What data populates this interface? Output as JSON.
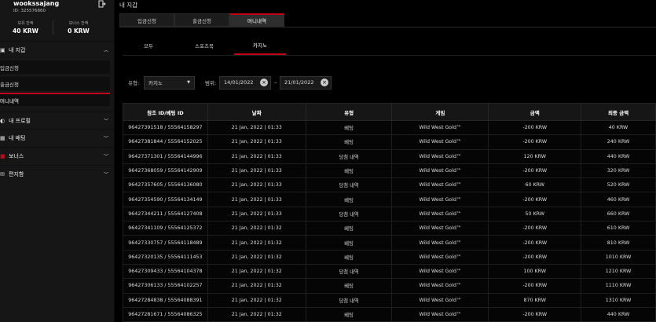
{
  "user": {
    "name": "wookssajang",
    "id": "ID: 325576860",
    "balance1_label": "보유 잔액",
    "balance1_value": "40 KRW",
    "balance2_label": "보너스 잔액",
    "balance2_value": "0 KRW"
  },
  "sidebar": {
    "wallet": "내 지갑",
    "wallet_items": [
      "입금신청",
      "출금신청",
      "머니내역"
    ],
    "profile": "내 프로필",
    "bets": "내 배팅",
    "bonus": "보너스",
    "messages": "편지함"
  },
  "page": {
    "title": "내 지갑"
  },
  "tabs": [
    "입금신청",
    "출금신청",
    "머니내역"
  ],
  "subtabs": [
    "모두",
    "스포츠북",
    "카지노"
  ],
  "filter": {
    "type_label": "유형:",
    "type_value": "카지노",
    "range_label": "범위:",
    "date_from": "14/01/2022",
    "date_to": "21/01/2022",
    "dash": "–"
  },
  "table": {
    "headers": [
      "참조 ID/베팅 ID",
      "날짜",
      "유형",
      "게임",
      "금액",
      "최종 금액"
    ],
    "rows": [
      [
        "96427391518 / 55564158297",
        "21 Jan, 2022 | 01:33",
        "베팅",
        "Wild West Gold™",
        "-200 KRW",
        "40 KRW"
      ],
      [
        "96427381844 / 55564152025",
        "21 Jan, 2022 | 01:33",
        "베팅",
        "Wild West Gold™",
        "-200 KRW",
        "240 KRW"
      ],
      [
        "96427371301 / 55564144996",
        "21 Jan, 2022 | 01:33",
        "당첨 내역",
        "Wild West Gold™",
        "120 KRW",
        "440 KRW"
      ],
      [
        "96427368059 / 55564142909",
        "21 Jan, 2022 | 01:33",
        "베팅",
        "Wild West Gold™",
        "-200 KRW",
        "320 KRW"
      ],
      [
        "96427357605 / 55564136080",
        "21 Jan, 2022 | 01:33",
        "당첨 내역",
        "Wild West Gold™",
        "60 KRW",
        "520 KRW"
      ],
      [
        "96427354590 / 55564134149",
        "21 Jan, 2022 | 01:33",
        "베팅",
        "Wild West Gold™",
        "-200 KRW",
        "460 KRW"
      ],
      [
        "96427344211 / 55564127408",
        "21 Jan, 2022 | 01:33",
        "당첨 내역",
        "Wild West Gold™",
        "50 KRW",
        "660 KRW"
      ],
      [
        "96427341109 / 55564125372",
        "21 Jan, 2022 | 01:32",
        "베팅",
        "Wild West Gold™",
        "-200 KRW",
        "610 KRW"
      ],
      [
        "96427330757 / 55564118489",
        "21 Jan, 2022 | 01:32",
        "베팅",
        "Wild West Gold™",
        "-200 KRW",
        "810 KRW"
      ],
      [
        "96427320135 / 55564111453",
        "21 Jan, 2022 | 01:32",
        "베팅",
        "Wild West Gold™",
        "-200 KRW",
        "1010 KRW"
      ],
      [
        "96427309433 / 55564104378",
        "21 Jan, 2022 | 01:32",
        "당첨 내역",
        "Wild West Gold™",
        "100 KRW",
        "1210 KRW"
      ],
      [
        "96427306133 / 55564102257",
        "21 Jan, 2022 | 01:32",
        "베팅",
        "Wild West Gold™",
        "-200 KRW",
        "1110 KRW"
      ],
      [
        "96427284838 / 55564088391",
        "21 Jan, 2022 | 01:32",
        "당첨 내역",
        "Wild West Gold™",
        "870 KRW",
        "1310 KRW"
      ],
      [
        "96427281671 / 55564086325",
        "21 Jan, 2022 | 01:32",
        "베팅",
        "Wild West Gold™",
        "-200 KRW",
        "440 KRW"
      ]
    ]
  }
}
